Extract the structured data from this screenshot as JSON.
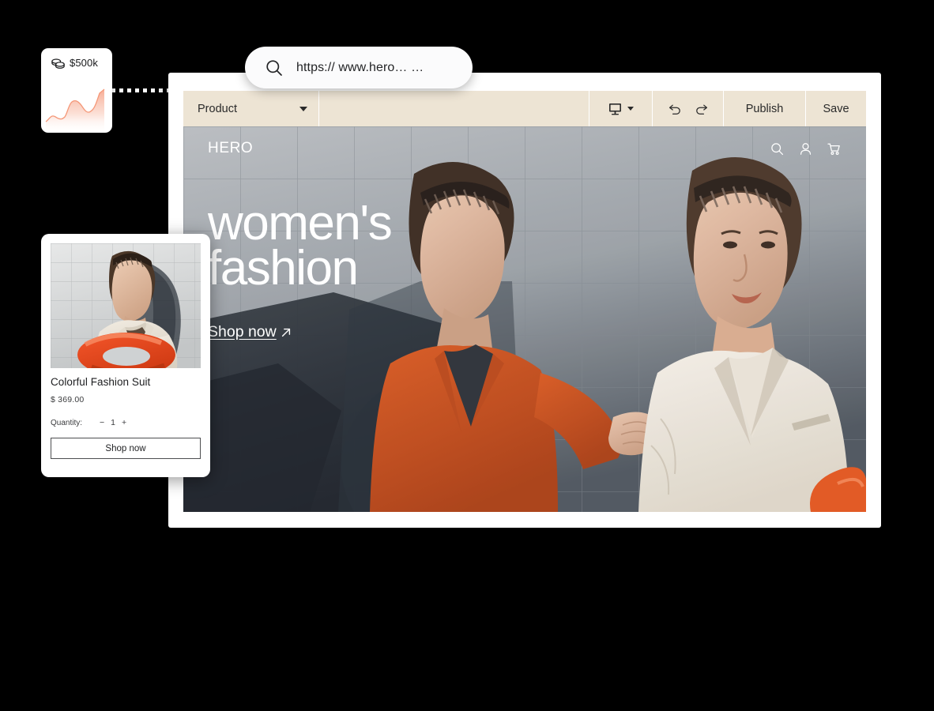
{
  "revenue_card": {
    "icon": "coins-icon",
    "amount": "$500k",
    "chart_data": {
      "type": "area",
      "title": "$500k",
      "xlabel": "",
      "ylabel": "",
      "grid": false,
      "legend": null,
      "x": [
        0,
        1,
        2,
        3,
        4,
        5,
        6,
        7,
        8,
        9,
        10,
        11
      ],
      "values": [
        20,
        26,
        38,
        34,
        30,
        58,
        70,
        66,
        52,
        44,
        60,
        92
      ],
      "ylim": [
        0,
        100
      ],
      "color": "#f4a48c",
      "fill": "gradient-salmon-to-white"
    }
  },
  "url_bar": {
    "icon": "search-icon",
    "value": "https:// www.hero… …",
    "placeholder": "https://"
  },
  "toolbar": {
    "product_label": "Product",
    "product_caret": "chevron-down-icon",
    "device_icon": "desktop-monitor-icon",
    "device_caret": "chevron-down-icon",
    "undo_icon": "undo-arrow-icon",
    "redo_icon": "redo-arrow-icon",
    "publish_label": "Publish",
    "save_label": "Save",
    "background": "#ede4d4"
  },
  "preview": {
    "logo": "HERO",
    "nav_icons": [
      "search-icon",
      "user-icon",
      "cart-icon"
    ],
    "hero_title": "women's\nfashion",
    "cta_label": "Shop now",
    "cta_icon": "arrow-up-right-icon"
  },
  "product_card": {
    "title": "Colorful Fashion Suit",
    "price": "$ 369.00",
    "quantity_label": "Quantity:",
    "decrement": "−",
    "quantity_value": "1",
    "increment": "+",
    "button_label": "Shop now"
  }
}
